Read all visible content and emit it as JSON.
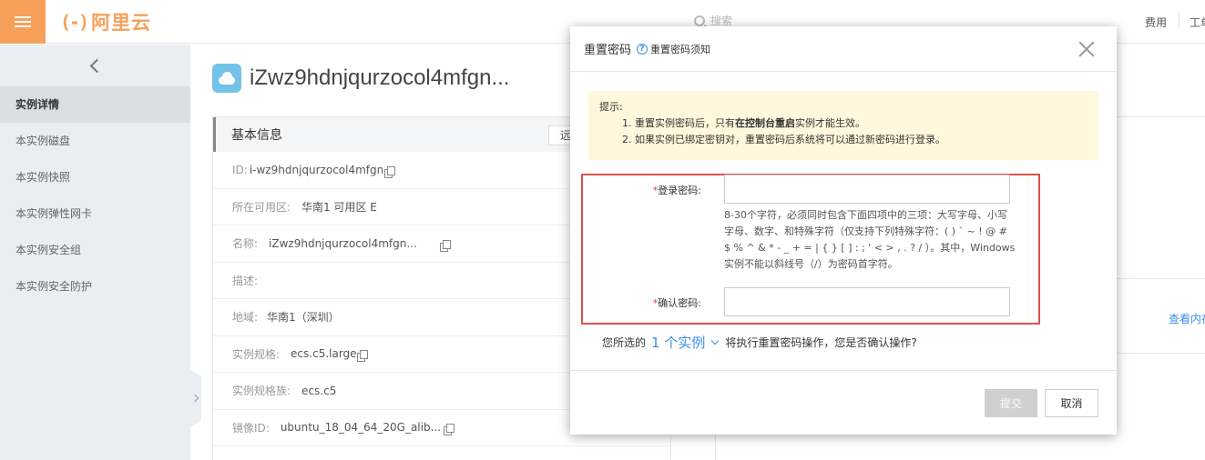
{
  "topbar": {
    "logo_mark": "(-)",
    "logo_text": "阿里云",
    "search_placeholder": "搜索",
    "links": [
      "费用",
      "工单"
    ]
  },
  "sidebar": {
    "items": [
      {
        "label": "实例详情",
        "active": true
      },
      {
        "label": "本实例磁盘",
        "active": false
      },
      {
        "label": "本实例快照",
        "active": false
      },
      {
        "label": "本实例弹性网卡",
        "active": false
      },
      {
        "label": "本实例安全组",
        "active": false
      },
      {
        "label": "本实例安全防护",
        "active": false
      }
    ]
  },
  "instance": {
    "title": "iZwz9hdnjqurzocol4mfgn..."
  },
  "basic_info": {
    "heading": "基本信息",
    "remote_button": "远程连接",
    "rows": [
      {
        "label": "ID:",
        "value": "i-wz9hdnjqurzocol4mfgn",
        "copy": true
      },
      {
        "label": "所在可用区:",
        "value": "华南1 可用区 E",
        "copy": false
      },
      {
        "label": "名称:",
        "value": "iZwz9hdnjqurzocol4mfgn...",
        "copy": true
      },
      {
        "label": "描述:",
        "value": "",
        "copy": false
      },
      {
        "label": "地域:",
        "value": "华南1（深圳）",
        "copy": false
      },
      {
        "label": "实例规格:",
        "value": "ecs.c5.large",
        "copy": true
      },
      {
        "label": "实例规格族:",
        "value": "ecs.c5",
        "copy": false
      },
      {
        "label": "镜像ID:",
        "value": "ubuntu_18_04_64_20G_alib...",
        "copy": true
      }
    ]
  },
  "right_panel": {
    "view_link": "查看内存"
  },
  "modal": {
    "title": "重置密码",
    "help_icon": "?",
    "help_link": "重置密码须知",
    "tip_title": "提示:",
    "tip1_pre": "1. 重置实例密码后，只有",
    "tip1_bold": "在控制台重启",
    "tip1_post": "实例才能生效。",
    "tip2": "2. 如果实例已绑定密钥对，重置密码后系统将可以通过新密码进行登录。",
    "required_mark": "*",
    "login_password_label": "登录密码:",
    "login_password_value": "",
    "password_hint": "8-30个字符，必须同时包含下面四项中的三项：大写字母、小写字母、数字、和特殊字符（仅支持下列特殊字符：( ) ` ~ ! @ # $ % ^ & * - _ + = | { } [ ] : ; ' < > , . ? / ）。其中，Windows 实例不能以斜线号（/）为密码首字符。",
    "confirm_password_label": "确认密码:",
    "confirm_password_value": "",
    "confirm_prefix": "您所选的",
    "confirm_count": "1 个实例",
    "confirm_suffix": "将执行重置密码操作，您是否确认操作?",
    "submit_label": "提交",
    "cancel_label": "取消"
  },
  "colors": {
    "brand_orange": "#f6a05a",
    "link_blue": "#3a8ee6",
    "required_red": "#e4393c",
    "highlight_border": "#d9534f",
    "tip_background": "#fff8dd"
  }
}
